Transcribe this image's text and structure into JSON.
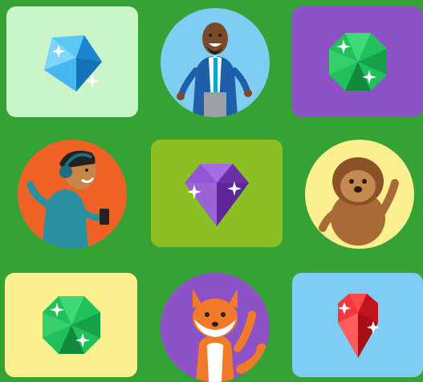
{
  "colors": {
    "background": "#34a234",
    "light_green": "#c9f5c9",
    "light_blue": "#7fcdf3",
    "purple": "#8e52c7",
    "orange": "#ee6226",
    "olive": "#8cbf24",
    "yellow": "#fbef90",
    "blue_gem": "#2aa3e8",
    "green_gem": "#20c05a",
    "purple_gem": "#7f3fbf",
    "red_gem": "#e0202a"
  },
  "board": {
    "rows": 3,
    "cols": 3,
    "tiles": [
      {
        "row": 0,
        "col": 0,
        "shape": "square",
        "bg": "light_green",
        "content": "blue-gem-icon"
      },
      {
        "row": 0,
        "col": 1,
        "shape": "circle",
        "bg": "light_blue",
        "content": "man-in-suit-avatar"
      },
      {
        "row": 0,
        "col": 2,
        "shape": "square",
        "bg": "purple",
        "content": "green-gem-icon"
      },
      {
        "row": 1,
        "col": 0,
        "shape": "circle",
        "bg": "orange",
        "content": "boy-with-headphones-avatar"
      },
      {
        "row": 1,
        "col": 1,
        "shape": "square",
        "bg": "olive",
        "content": "purple-gem-icon"
      },
      {
        "row": 1,
        "col": 2,
        "shape": "circle",
        "bg": "yellow",
        "content": "hedgehog-avatar"
      },
      {
        "row": 2,
        "col": 0,
        "shape": "square",
        "bg": "yellow",
        "content": "green-gem-icon"
      },
      {
        "row": 2,
        "col": 1,
        "shape": "circle",
        "bg": "purple",
        "content": "fox-avatar"
      },
      {
        "row": 2,
        "col": 2,
        "shape": "square",
        "bg": "light_blue",
        "content": "red-gem-icon"
      }
    ]
  }
}
